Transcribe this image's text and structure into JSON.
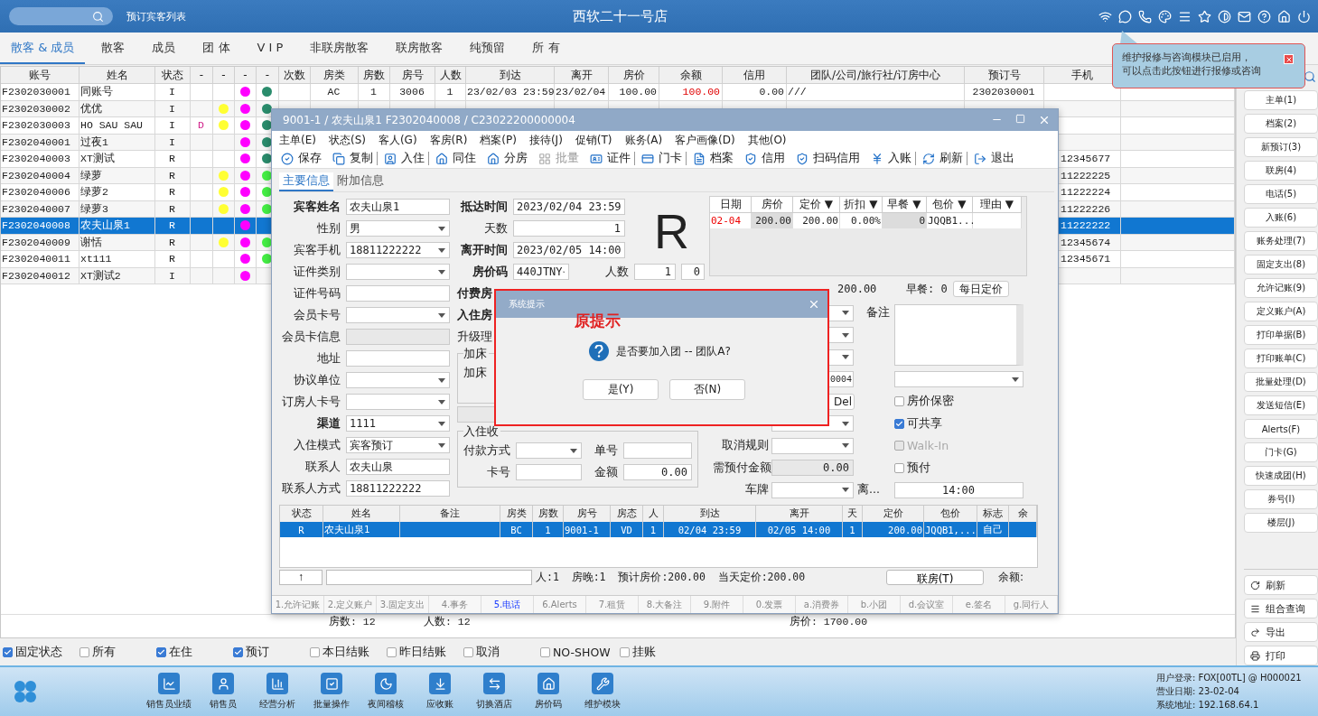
{
  "topbar": {
    "page_title": "预订宾客列表",
    "hotel": "西软二十一号店"
  },
  "tooltip": {
    "lines": [
      "维护报修与咨询模块已启用，",
      "可以点击此按钮进行报修或咨询"
    ]
  },
  "tabs": [
    {
      "label": "散客 & 成员",
      "selected": true
    },
    {
      "label": "散客",
      "selected": false
    },
    {
      "label": "成员",
      "selected": false
    },
    {
      "label": "团 体",
      "selected": false
    },
    {
      "label": "V I P",
      "selected": false
    },
    {
      "label": "非联房散客",
      "selected": false
    },
    {
      "label": "联房散客",
      "selected": false
    },
    {
      "label": "纯预留",
      "selected": false
    },
    {
      "label": "所 有",
      "selected": false
    }
  ],
  "table": {
    "columns": [
      "账号",
      "姓名",
      "状态",
      "-",
      "-",
      "-",
      "-",
      "次数",
      "房类",
      "房数",
      "房号",
      "人数",
      "到达",
      "离开",
      "房价",
      "余额",
      "信用",
      "团队/公司/旅行社/订房中心",
      "预订号",
      "手机"
    ],
    "rows": [
      {
        "account": "F2302030001",
        "name": "同账号",
        "status": "I",
        "dot_2": {
          "color": "#ff00ff"
        },
        "dot_3": {
          "color": "#2a8c6c"
        },
        "room_type": "AC",
        "rooms": "1",
        "room_no": "3006",
        "guests": "1",
        "arrive": "23/02/03 23:59",
        "depart": "23/02/04",
        "rate": "100.00",
        "balance": "100.00",
        "credit": "0.00",
        "group": "///",
        "booking_no": "2302030001",
        "selected": false
      },
      {
        "account": "F2302030002",
        "name": "优优",
        "status": "I",
        "dot_1": {
          "color": "#ffff33"
        },
        "dot_2": {
          "color": "#ff00ff"
        },
        "dot_3": {
          "color": "#2a8c6c"
        },
        "selected": false
      },
      {
        "account": "F2302030003",
        "name": "HO SAU SAU",
        "status": "I",
        "flag": "D",
        "dot_1": {
          "color": "#ffff33"
        },
        "dot_2": {
          "color": "#ff00ff"
        },
        "dot_3": {
          "color": "#2a8c6c"
        },
        "selected": false
      },
      {
        "account": "F2302040001",
        "name": "过夜1",
        "status": "I",
        "dot_2": {
          "color": "#ff00ff"
        },
        "dot_3": {
          "color": "#2a8c6c"
        },
        "selected": false
      },
      {
        "account": "F2302040003",
        "name": "XT测试",
        "status": "R",
        "dot_2": {
          "color": "#ff00ff"
        },
        "dot_3": {
          "color": "#2a8c6c"
        },
        "phone": "12345677",
        "selected": false
      },
      {
        "account": "F2302040004",
        "name": "绿萝",
        "status": "R",
        "dot_1": {
          "color": "#ffff33"
        },
        "dot_2": {
          "color": "#ff00ff"
        },
        "dot_3": {
          "color": "#44ee44"
        },
        "phone": "11222225",
        "selected": false
      },
      {
        "account": "F2302040006",
        "name": "绿萝2",
        "status": "R",
        "dot_1": {
          "color": "#ffff33"
        },
        "dot_2": {
          "color": "#ff00ff"
        },
        "dot_3": {
          "color": "#44ee44"
        },
        "phone": "11222224",
        "selected": false
      },
      {
        "account": "F2302040007",
        "name": "绿萝3",
        "status": "R",
        "dot_1": {
          "color": "#ffff33"
        },
        "dot_2": {
          "color": "#ff00ff"
        },
        "dot_3": {
          "color": "#44ee44"
        },
        "phone": "11222226",
        "selected": false
      },
      {
        "account": "F2302040008",
        "name": "农夫山泉1",
        "status": "R",
        "dot_2": {
          "color": "#ff00ff"
        },
        "phone": "11222222",
        "selected": true
      },
      {
        "account": "F2302040009",
        "name": "谢恬",
        "status": "R",
        "dot_1": {
          "color": "#ffff33"
        },
        "dot_2": {
          "color": "#ff00ff"
        },
        "dot_3": {
          "color": "#44ee44"
        },
        "phone": "12345674",
        "selected": false
      },
      {
        "account": "F2302040011",
        "name": "xt111",
        "status": "R",
        "dot_2": {
          "color": "#ff00ff"
        },
        "dot_3": {
          "color": "#44ee44"
        },
        "phone": "12345671",
        "selected": false
      },
      {
        "account": "F2302040012",
        "name": "XT测试2",
        "status": "I",
        "dot_2": {
          "color": "#ff00ff"
        },
        "selected": false
      }
    ]
  },
  "summary": {
    "rooms": "房数: 12",
    "people": "人数: 12",
    "price": "房价: 1700.00"
  },
  "sidebar": {
    "buttons": [
      "主单(1)",
      "档案(2)",
      "新预订(3)",
      "联房(4)",
      "电话(5)",
      "入账(6)",
      "账务处理(7)",
      "固定支出(8)",
      "允许记账(9)",
      "定义账户(A)",
      "打印单据(B)",
      "打印账单(C)",
      "批量处理(D)",
      "发送短信(E)",
      "Alerts(F)",
      "门卡(G)",
      "快速成团(H)",
      "券号(I)",
      "楼层(J)"
    ],
    "actions": [
      "刷新",
      "组合查询",
      "导出",
      "打印"
    ]
  },
  "filters": [
    {
      "label": "固定状态",
      "checked": true
    },
    {
      "label": "所有",
      "checked": false
    },
    {
      "label": "在住",
      "checked": true
    },
    {
      "label": "预订",
      "checked": true
    },
    {
      "label": "本日结账",
      "checked": false
    },
    {
      "label": "昨日结账",
      "checked": false
    },
    {
      "label": "取消",
      "checked": false
    },
    {
      "label": "NO-SHOW",
      "checked": false
    },
    {
      "label": "挂账",
      "checked": false
    }
  ],
  "dock": {
    "items": [
      "销售员业绩",
      "销售员",
      "经营分析",
      "批量操作",
      "夜间稽核",
      "应收账",
      "切换酒店",
      "房价码",
      "维护模块"
    ],
    "info": [
      "用户登录: FOX[00TL] @ H000021",
      "营业日期: 23-02-04",
      "系统地址: 192.168.64.1"
    ]
  },
  "window": {
    "title": "9001-1 / 农夫山泉1 F2302040008 / C23022200000004",
    "menu": [
      "主单(E)",
      "状态(S)",
      "客人(G)",
      "客房(R)",
      "档案(P)",
      "接待(J)",
      "促销(T)",
      "账务(A)",
      "客户画像(D)",
      "其他(O)"
    ],
    "toolbar": [
      {
        "label": "保存",
        "disabled": false,
        "separator_after": false
      },
      {
        "label": "复制",
        "disabled": false,
        "separator_after": true
      },
      {
        "label": "入住",
        "disabled": false,
        "separator_after": true
      },
      {
        "label": "同住",
        "disabled": false,
        "separator_after": false
      },
      {
        "label": "分房",
        "disabled": false,
        "separator_after": false
      },
      {
        "label": "批量",
        "disabled": true,
        "separator_after": false
      },
      {
        "label": "证件",
        "disabled": false,
        "separator_after": true
      },
      {
        "label": "门卡",
        "disabled": false,
        "separator_after": true
      },
      {
        "label": "档案",
        "disabled": false,
        "separator_after": false
      },
      {
        "label": "信用",
        "disabled": false,
        "separator_after": false
      },
      {
        "label": "扫码信用",
        "disabled": false,
        "separator_after": false
      },
      {
        "label": "入账",
        "disabled": false,
        "separator_after": true
      },
      {
        "label": "刷新",
        "disabled": false,
        "separator_after": true
      },
      {
        "label": "退出",
        "disabled": false,
        "separator_after": false
      }
    ],
    "tabs": [
      {
        "label": "主要信息",
        "selected": true
      },
      {
        "label": "附加信息",
        "selected": false
      }
    ],
    "left_fields": [
      {
        "label": "宾客姓名",
        "bold": true,
        "kind": "input",
        "value": "农夫山泉1"
      },
      {
        "label": "性别",
        "bold": false,
        "kind": "select",
        "value": "男"
      },
      {
        "label": "宾客手机",
        "bold": false,
        "kind": "select",
        "value": "18811222222"
      },
      {
        "label": "证件类别",
        "bold": false,
        "kind": "select"
      },
      {
        "label": "证件号码",
        "bold": false,
        "kind": "input"
      },
      {
        "label": "会员卡号",
        "bold": false,
        "kind": "select"
      },
      {
        "label": "会员卡信息",
        "bold": false,
        "kind": "readonly"
      },
      {
        "label": "地址",
        "bold": false,
        "kind": "input"
      },
      {
        "label": "协议单位",
        "bold": false,
        "kind": "select"
      },
      {
        "label": "订房人卡号",
        "bold": false,
        "kind": "select"
      },
      {
        "label": "渠道",
        "bold": true,
        "kind": "select",
        "value": "1111"
      },
      {
        "label": "入住模式",
        "bold": false,
        "kind": "select",
        "value": "宾客预订"
      },
      {
        "label": "联系人",
        "bold": false,
        "kind": "input",
        "value": "农夫山泉"
      },
      {
        "label": "联系人方式",
        "bold": false,
        "kind": "input",
        "value": "18811222222"
      }
    ],
    "mid_fields": [
      {
        "label": "抵达时间",
        "bold": true,
        "kind": "select",
        "value": "2023/02/04 23:59"
      },
      {
        "label": "天数",
        "bold": false,
        "kind": "number",
        "value": "1"
      },
      {
        "label": "离开时间",
        "bold": true,
        "kind": "select",
        "value": "2023/02/05 14:00"
      }
    ],
    "status_letter": "R",
    "rate_code": {
      "label": "房价码",
      "value": "440JTNY",
      "people_label": "人数",
      "people": "1",
      "children": "0"
    },
    "cut_labels": [
      {
        "label": "付费房",
        "bold": true
      },
      {
        "label": "入住房",
        "bold": true
      },
      {
        "label": "升级理",
        "bold": false
      }
    ],
    "extra_bed": {
      "legend": "加床",
      "label": "加床"
    },
    "payment": {
      "legend": "入住收",
      "method_label": "付款方式",
      "order_label": "单号",
      "card_label": "卡号",
      "amount_label": "金额",
      "amount": "0.00"
    },
    "rate_table": {
      "columns": [
        "日期",
        "房价",
        "定价 ▼",
        "折扣 ▼",
        "早餐 ▼",
        "包价 ▼",
        "理由 ▼"
      ],
      "row": [
        "02-04",
        "200.00",
        "200.00",
        "0.00%",
        "0",
        "JQQB1..."
      ]
    },
    "rate_summary": {
      "price": "200.00",
      "breakfast": "早餐: 0",
      "button": "每日定价"
    },
    "right_fields": {
      "code": "0004",
      "del": "Del",
      "cancel_label": "取消规则",
      "prepay_label": "需预付金额",
      "prepay": "0.00",
      "plate_label": "车牌",
      "leave_label": "离...",
      "leave": "14:00",
      "remark_label": "备注"
    },
    "options": [
      {
        "label": "房价保密",
        "checked": false,
        "disabled": false
      },
      {
        "label": "可共享",
        "checked": true,
        "disabled": false
      },
      {
        "label": "Walk-In",
        "checked": false,
        "disabled": true
      },
      {
        "label": "预付",
        "checked": false,
        "disabled": false
      }
    ],
    "guests": {
      "columns": [
        "状态",
        "姓名",
        "备注",
        "房类",
        "房数",
        "房号",
        "房态",
        "人",
        "到达",
        "离开",
        "天",
        "定价",
        "包价",
        "标志",
        "余"
      ],
      "rows": [
        {
          "cells": [
            "R",
            "农夫山泉1",
            null,
            "BC",
            "1",
            "9001-1",
            "VD",
            "1",
            "02/04 23:59",
            "02/05 14:00",
            "1",
            "200.00",
            "JQQB1,...",
            "自己",
            null
          ],
          "selected": true
        }
      ]
    },
    "footer": {
      "up": "↑",
      "stats": "人:1  房晚:1  预计房价:200.00  当天定价:200.00",
      "link_button": "联房(T)",
      "balance": "余额:"
    },
    "bottom_tabs": [
      {
        "label": "1.允许记账",
        "selected": false
      },
      {
        "label": "2.定义账户",
        "selected": false
      },
      {
        "label": "3.固定支出",
        "selected": false
      },
      {
        "label": "4.事务",
        "selected": false
      },
      {
        "label": "5.电话",
        "selected": true
      },
      {
        "label": "6.Alerts",
        "selected": false
      },
      {
        "label": "7.租赁",
        "selected": false
      },
      {
        "label": "8.大备注",
        "selected": false
      },
      {
        "label": "9.附件",
        "selected": false
      },
      {
        "label": "0.发票",
        "selected": false
      },
      {
        "label": "a.消费券",
        "selected": false
      },
      {
        "label": "b.小团",
        "selected": false
      },
      {
        "label": "d.会议室",
        "selected": false
      },
      {
        "label": "e.签名",
        "selected": false
      },
      {
        "label": "g.同行人",
        "selected": false
      }
    ]
  },
  "dialog": {
    "title": "系统提示",
    "annotation": "原提示",
    "message": "是否要加入团 -- 团队A?",
    "buttons": [
      "是(Y)",
      "否(N)"
    ]
  }
}
